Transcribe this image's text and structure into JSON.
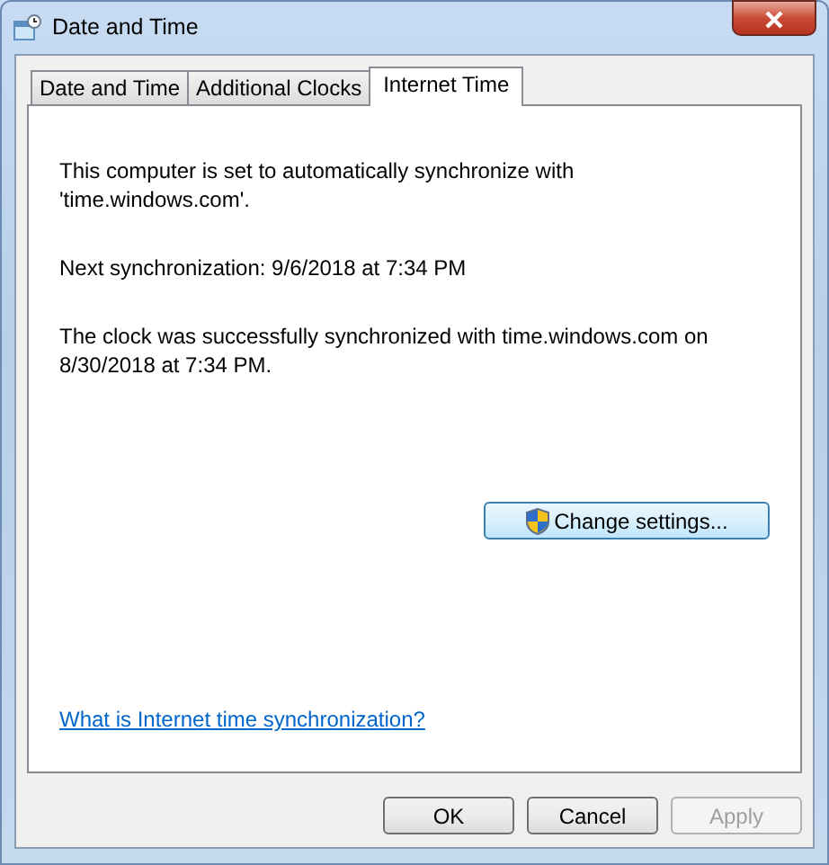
{
  "window": {
    "title": "Date and Time"
  },
  "tabs": [
    {
      "label": "Date and Time",
      "selected": false
    },
    {
      "label": "Additional Clocks",
      "selected": false
    },
    {
      "label": "Internet Time",
      "selected": true
    }
  ],
  "panel": {
    "paragraphs": [
      "This computer is set to automatically synchronize with 'time.windows.com'.",
      "Next synchronization: 9/6/2018 at 7:34 PM",
      "The clock was successfully synchronized with time.windows.com on 8/30/2018 at 7:34 PM."
    ],
    "change_button": {
      "label": "Change settings..."
    },
    "help_link": "What is Internet time synchronization?"
  },
  "buttons": [
    {
      "label": "OK",
      "disabled": false
    },
    {
      "label": "Cancel",
      "disabled": false
    },
    {
      "label": "Apply",
      "disabled": true
    }
  ]
}
